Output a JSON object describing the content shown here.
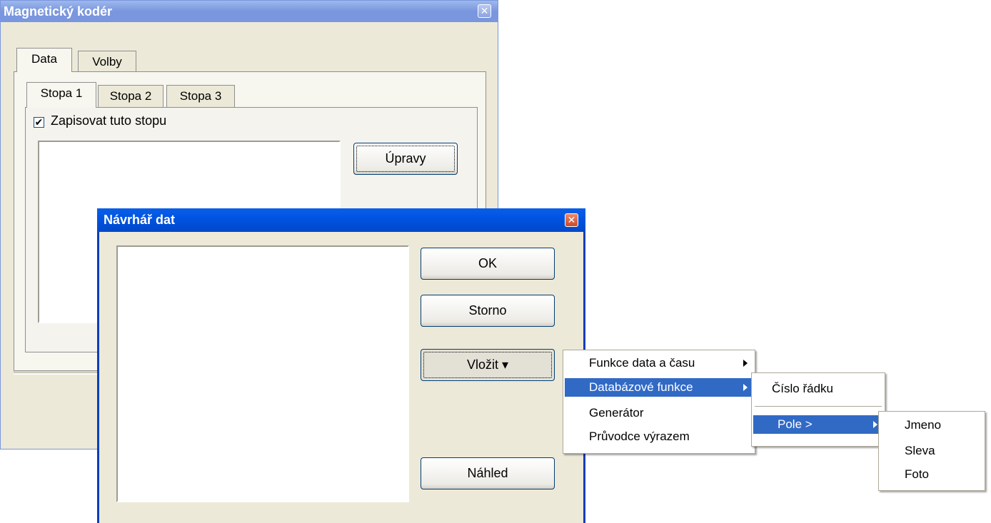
{
  "encoder": {
    "title": "Magnetický kodér",
    "tabs": [
      "Data",
      "Volby"
    ],
    "subtabs": [
      "Stopa 1",
      "Stopa 2",
      "Stopa 3"
    ],
    "checkbox_label": "Zapisovat tuto stopu",
    "checkbox_checked": true,
    "edit_button": "Úpravy"
  },
  "designer": {
    "title": "Návrhář dat",
    "ok": "OK",
    "cancel": "Storno",
    "insert": "Vložit ▾",
    "preview": "Náhled"
  },
  "menu": {
    "items": [
      "Funkce data a času",
      "Databázové funkce",
      "Generátor",
      "Průvodce výrazem"
    ],
    "submenu": {
      "row_number": "Číslo řádku",
      "field": "Pole >"
    },
    "fields": [
      "Jmeno",
      "Sleva",
      "Foto"
    ]
  },
  "colors": {
    "highlight": "#316ac5",
    "face": "#ece9d8"
  }
}
